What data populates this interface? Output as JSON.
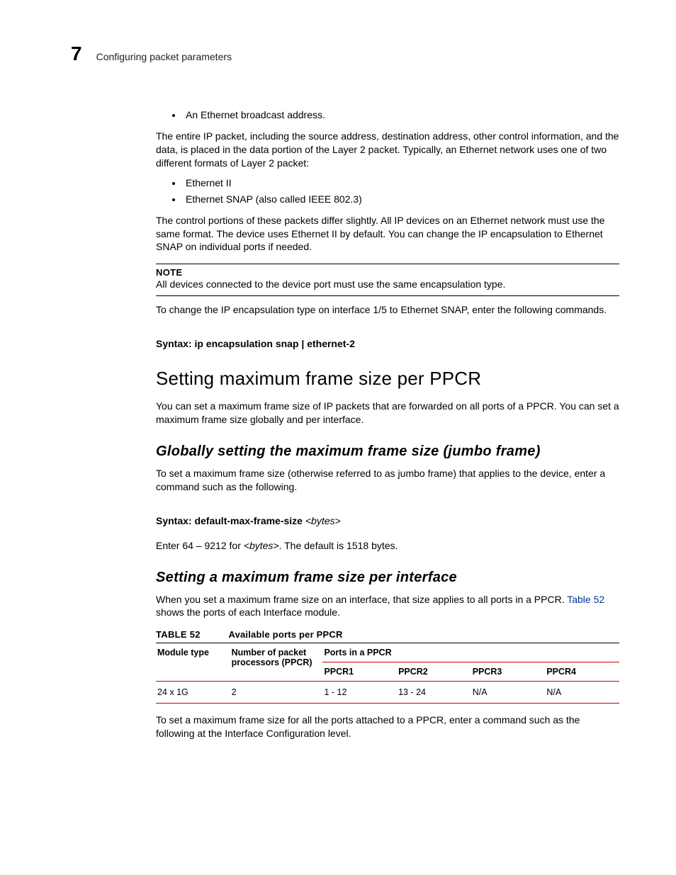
{
  "header": {
    "chapter_number": "7",
    "chapter_title": "Configuring packet parameters"
  },
  "body": {
    "bullet1": "An Ethernet broadcast address.",
    "p1": "The entire IP packet, including the source address, destination address, other control information, and the data, is placed in the data portion of the Layer 2 packet. Typically, an Ethernet network uses one of two different formats of Layer 2 packet:",
    "bullet2a": "Ethernet II",
    "bullet2b": "Ethernet SNAP (also called IEEE 802.3)",
    "p2": "The control portions of these packets differ slightly. All IP devices on an Ethernet network must use the same format. The device uses Ethernet II by default. You can change the IP encapsulation to Ethernet SNAP on individual ports if needed.",
    "note_label": "NOTE",
    "note_body": "All devices connected to the device port must use the same encapsulation type.",
    "p3": "To change the IP encapsulation type on interface 1/5 to Ethernet SNAP, enter the following commands.",
    "syntax1_label": "Syntax:",
    "syntax1_cmd": " ip encapsulation snap | ethernet-2",
    "h2": "Setting maximum frame size per PPCR",
    "p4": "You can set a maximum frame size of IP packets that are forwarded on all ports of a PPCR. You can set a maximum frame size globally and per interface.",
    "h3a": "Globally setting the maximum frame size (jumbo frame)",
    "p5": "To set a maximum frame size (otherwise referred to as jumbo frame) that applies to the device, enter a command such as the following.",
    "syntax2_label": "Syntax:",
    "syntax2_cmd": " default-max-frame-size",
    "syntax2_arg": " <bytes>",
    "p6a": "Enter 64 – 9212 for ",
    "p6b": "<bytes>",
    "p6c": ". The default is 1518 bytes.",
    "h3b": "Setting a maximum frame size per interface",
    "p7a": "When you set a maximum frame size on an interface, that size applies to all ports in a PPCR. ",
    "p7_link": "Table 52",
    "p7b": " shows the ports of each Interface module.",
    "table_label": "TABLE 52",
    "table_caption": "Available ports per PPCR",
    "th_module": "Module type",
    "th_numpp": "Number of packet processors (PPCR)",
    "th_ports": "Ports in a PPCR",
    "th_p1": "PPCR1",
    "th_p2": "PPCR2",
    "th_p3": "PPCR3",
    "th_p4": "PPCR4",
    "row1": {
      "module": "24 x 1G",
      "num": "2",
      "p1": "1 - 12",
      "p2": "13 - 24",
      "p3": "N/A",
      "p4": "N/A"
    },
    "p8": "To set a maximum frame size for all the ports attached to a PPCR, enter a command such as the following at the Interface Configuration level."
  }
}
